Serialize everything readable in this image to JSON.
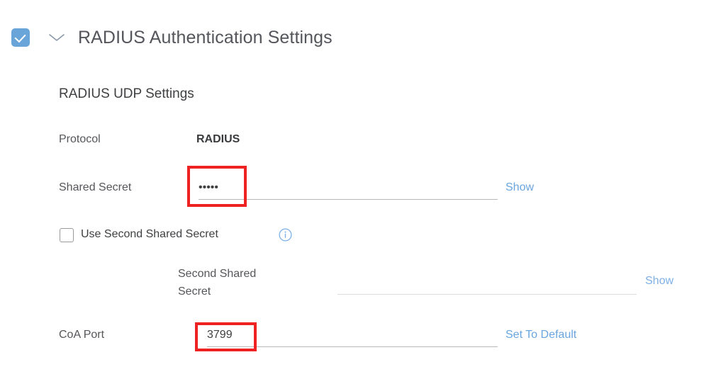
{
  "section": {
    "enabled": true,
    "expanded": true,
    "title": "RADIUS Authentication Settings",
    "checkbox_icon": "checkbox-checked-icon",
    "chevron_icon": "chevron-down-icon",
    "accent_color": "#6aa5d9"
  },
  "subsection": {
    "title": "RADIUS UDP Settings"
  },
  "fields": {
    "protocol": {
      "label": "Protocol",
      "value": "RADIUS"
    },
    "shared_secret": {
      "label": "Shared Secret",
      "value": "•••••",
      "masked_char_count": 5,
      "action_label": "Show",
      "highlighted": true
    },
    "use_second_shared_secret": {
      "label": "Use Second Shared Secret",
      "checked": false,
      "info_icon": "info-circle-icon"
    },
    "second_shared_secret": {
      "label_line1": "Second Shared",
      "label_line2": "Secret",
      "value": "",
      "action_label": "Show",
      "disabled": true
    },
    "coa_port": {
      "label": "CoA Port",
      "value": "3799",
      "action_label": "Set To Default",
      "highlighted": true
    }
  },
  "annotations": {
    "color": "#ee2222",
    "shared_secret_box": "highlight-box-shared-secret",
    "coa_port_box": "highlight-box-coa-port"
  }
}
